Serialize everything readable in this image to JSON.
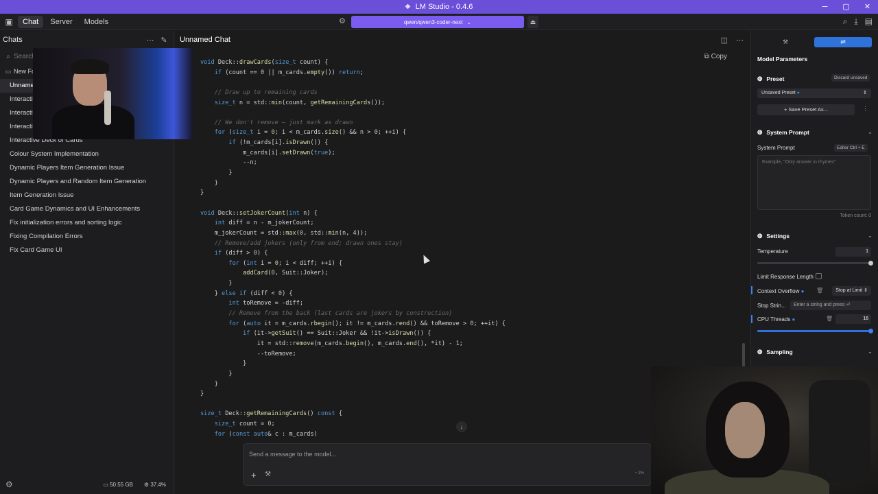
{
  "window": {
    "title": "LM Studio - 0.4.6"
  },
  "nav": {
    "tabs": [
      "Chat",
      "Server",
      "Models"
    ],
    "active": "Chat"
  },
  "model_selector": {
    "label": "qwen/qwen3-coder-next"
  },
  "sidebar": {
    "header": "Chats",
    "search_placeholder": "Search",
    "new_folder_label": "New Fo",
    "chats": [
      "Unnamed Chat",
      "Interactive Deck of Cards",
      "Interactive Deck of Cards",
      "Interactive Deck of Cards",
      "Interactive Deck of Cards",
      "Colour System Implementation",
      "Dynamic Players Item Generation Issue",
      "Dynamic Players and Random Item Generation",
      "Item Generation Issue",
      "Card Game Dynamics and UI Enhancements",
      "Fix initialization errors and sorting logic",
      "Fixing Compilation Errors",
      "Fix Card Game UI"
    ],
    "ram": "50.55 GB",
    "cpu": "37.4%"
  },
  "chat": {
    "title": "Unnamed Chat",
    "copy_label": "Copy",
    "composer_placeholder": "Send a message to the model...",
    "context_usage": "2%"
  },
  "code_lines": [
    "void Deck::drawCards(size_t count) {",
    "    if (count == 0 || m_cards.empty()) return;",
    "",
    "    // Draw up to remaining cards",
    "    size_t n = std::min(count, getRemainingCards());",
    "",
    "    // We don't remove — just mark as drawn",
    "    for (size_t i = 0; i < m_cards.size() && n > 0; ++i) {",
    "        if (!m_cards[i].isDrawn()) {",
    "            m_cards[i].setDrawn(true);",
    "            --n;",
    "        }",
    "    }",
    "}",
    "",
    "void Deck::setJokerCount(int n) {",
    "    int diff = n - m_jokerCount;",
    "    m_jokerCount = std::max(0, std::min(n, 4));",
    "    // Remove/add jokers (only from end; drawn ones stay)",
    "    if (diff > 0) {",
    "        for (int i = 0; i < diff; ++i) {",
    "            addCard(0, Suit::Joker);",
    "        }",
    "    } else if (diff < 0) {",
    "        int toRemove = -diff;",
    "        // Remove from the back (last cards are jokers by construction)",
    "        for (auto it = m_cards.rbegin(); it != m_cards.rend() && toRemove > 0; ++it) {",
    "            if (it->getSuit() == Suit::Joker && !it->isDrawn()) {",
    "                it = std::remove(m_cards.begin(), m_cards.end(), *it) - 1;",
    "                --toRemove;",
    "            }",
    "        }",
    "    }",
    "}",
    "",
    "size_t Deck::getRemainingCards() const {",
    "    size_t count = 0;",
    "    for (const auto& c : m_cards)"
  ],
  "right_panel": {
    "title": "Model Parameters",
    "preset": {
      "header": "Preset",
      "discard": "Discard unsaved",
      "value": "Unsaved Preset",
      "save": "Save Preset As..."
    },
    "system_prompt": {
      "header": "System Prompt",
      "label": "System Prompt",
      "editor": "Editor  Ctrl + E",
      "placeholder": "Example, \"Only answer in rhymes\"",
      "token_count": "Token count: 0"
    },
    "settings": {
      "header": "Settings",
      "temperature_label": "Temperature",
      "temperature": "1",
      "temperature_level": 1.0,
      "limit_label": "Limit Response Length",
      "overflow_label": "Context Overflow",
      "overflow_value": "Stop at Limit",
      "stop_label": "Stop Strin...",
      "stop_placeholder": "Enter a string and press ⏎",
      "cpu_label": "CPU Threads",
      "cpu_value": "16",
      "cpu_level": 1.0
    },
    "sampling": {
      "header": "Sampling"
    }
  }
}
